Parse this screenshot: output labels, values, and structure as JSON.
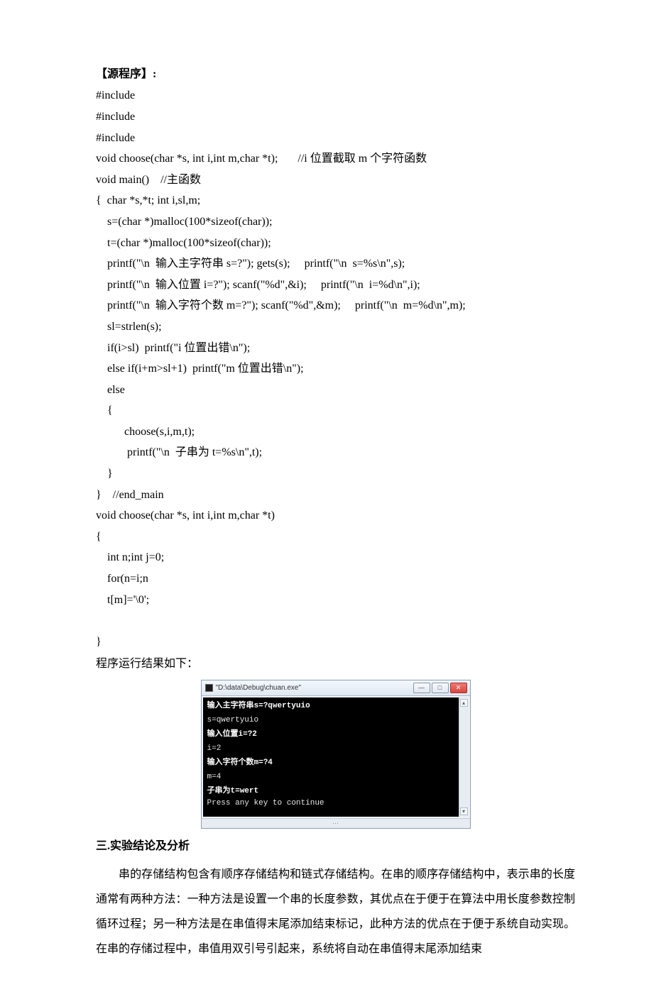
{
  "heading_source": "【源程序】:",
  "code_lines": [
    "#include",
    "#include",
    "#include",
    "void choose(char *s, int i,int m,char *t);       //i 位置截取 m 个字符函数",
    "void main()    //主函数",
    "{  char *s,*t; int i,sl,m;",
    "    s=(char *)malloc(100*sizeof(char));",
    "    t=(char *)malloc(100*sizeof(char));",
    "    printf(\"\\n  输入主字符串 s=?\"); gets(s);     printf(\"\\n  s=%s\\n\",s);",
    "    printf(\"\\n  输入位置 i=?\"); scanf(\"%d\",&i);     printf(\"\\n  i=%d\\n\",i);",
    "    printf(\"\\n  输入字符个数 m=?\"); scanf(\"%d\",&m);     printf(\"\\n  m=%d\\n\",m);",
    "    sl=strlen(s);",
    "    if(i>sl)  printf(\"i 位置出错\\n\");",
    "    else if(i+m>sl+1)  printf(\"m 位置出错\\n\");",
    "    else",
    "    {",
    "          choose(s,i,m,t);",
    "           printf(\"\\n  子串为 t=%s\\n\",t);",
    "    }",
    "}    //end_main",
    "void choose(char *s, int i,int m,char *t)",
    "{",
    "    int n;int j=0;",
    "    for(n=i;n",
    "    t[m]='\\0';",
    "",
    "}"
  ],
  "result_label": "程序运行结果如下：",
  "console": {
    "title": "\"D:\\data\\Debug\\chuan.exe\"",
    "lines": [
      {
        "text": "输入主字符串s=?qwertyuio",
        "bold": true
      },
      {
        "text": "s=qwertyuio",
        "bold": false
      },
      {
        "text": "输入位置i=?2",
        "bold": true
      },
      {
        "text": "i=2",
        "bold": false
      },
      {
        "text": "输入字符个数m=?4",
        "bold": true
      },
      {
        "text": "m=4",
        "bold": false
      },
      {
        "text": "子串为t=wert",
        "bold": true
      },
      {
        "text": "Press any key to continue",
        "bold": false
      }
    ],
    "buttons": {
      "min": "—",
      "max": "□",
      "close": "✕"
    },
    "scroll": {
      "up": "▴",
      "down": "▾",
      "hmark": "⋯"
    }
  },
  "section3_title": "三.实验结论及分析",
  "section3_body": "串的存储结构包含有顺序存储结构和链式存储结构。在串的顺序存储结构中，表示串的长度通常有两种方法：一种方法是设置一个串的长度参数，其优点在于便于在算法中用长度参数控制循环过程；另一种方法是在串值得末尾添加结束标记，此种方法的优点在于便于系统自动实现。在串的存储过程中，串值用双引号引起来，系统将自动在串值得末尾添加结束"
}
